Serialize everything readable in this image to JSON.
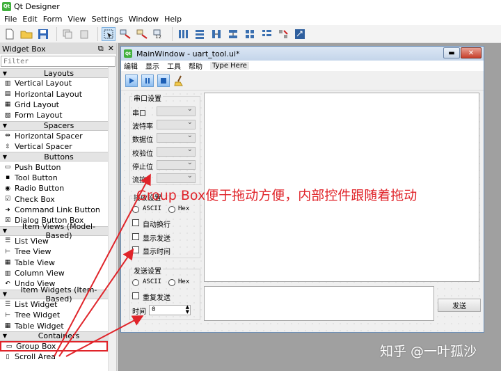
{
  "app": {
    "title": "Qt Designer",
    "logo": "Qt"
  },
  "menubar": [
    "File",
    "Edit",
    "Form",
    "View",
    "Settings",
    "Window",
    "Help"
  ],
  "widget_box": {
    "title": "Widget Box",
    "filter_placeholder": "Filter",
    "categories": [
      {
        "label": "Layouts",
        "items": [
          "Vertical Layout",
          "Horizontal Layout",
          "Grid Layout",
          "Form Layout"
        ]
      },
      {
        "label": "Spacers",
        "items": [
          "Horizontal Spacer",
          "Vertical Spacer"
        ]
      },
      {
        "label": "Buttons",
        "items": [
          "Push Button",
          "Tool Button",
          "Radio Button",
          "Check Box",
          "Command Link Button",
          "Dialog Button Box"
        ]
      },
      {
        "label": "Item Views (Model-Based)",
        "items": [
          "List View",
          "Tree View",
          "Table View",
          "Column View",
          "Undo View"
        ]
      },
      {
        "label": "Item Widgets (Item-Based)",
        "items": [
          "List Widget",
          "Tree Widget",
          "Table Widget"
        ]
      },
      {
        "label": "Containers",
        "items": [
          "Group Box",
          "Scroll Area"
        ]
      }
    ]
  },
  "form": {
    "title": "MainWindow - uart_tool.ui*",
    "menus": [
      "编辑",
      "显示",
      "工具",
      "帮助"
    ],
    "type_here": "Type Here",
    "serial_group": {
      "title": "串口设置",
      "fields": [
        "串口",
        "波特率",
        "数据位",
        "校验位",
        "停止位",
        "流控"
      ]
    },
    "recv_group": {
      "title": "接收设置",
      "ascii": "ASCII",
      "hex": "Hex",
      "checks": [
        "自动换行",
        "显示发送",
        "显示时间"
      ]
    },
    "send_group": {
      "title": "发送设置",
      "ascii": "ASCII",
      "hex": "Hex",
      "repeat": "重复发送",
      "time_label": "时间",
      "time_value": "0"
    },
    "send_button": "发送"
  },
  "annotation": "Group Box便于拖动方便，内部控件跟随着拖动",
  "watermark": "知乎 @一叶孤沙",
  "colors": {
    "annotation": "#e0242a",
    "qt_green": "#41b03e",
    "mdi_bg": "#a0a0a0"
  }
}
